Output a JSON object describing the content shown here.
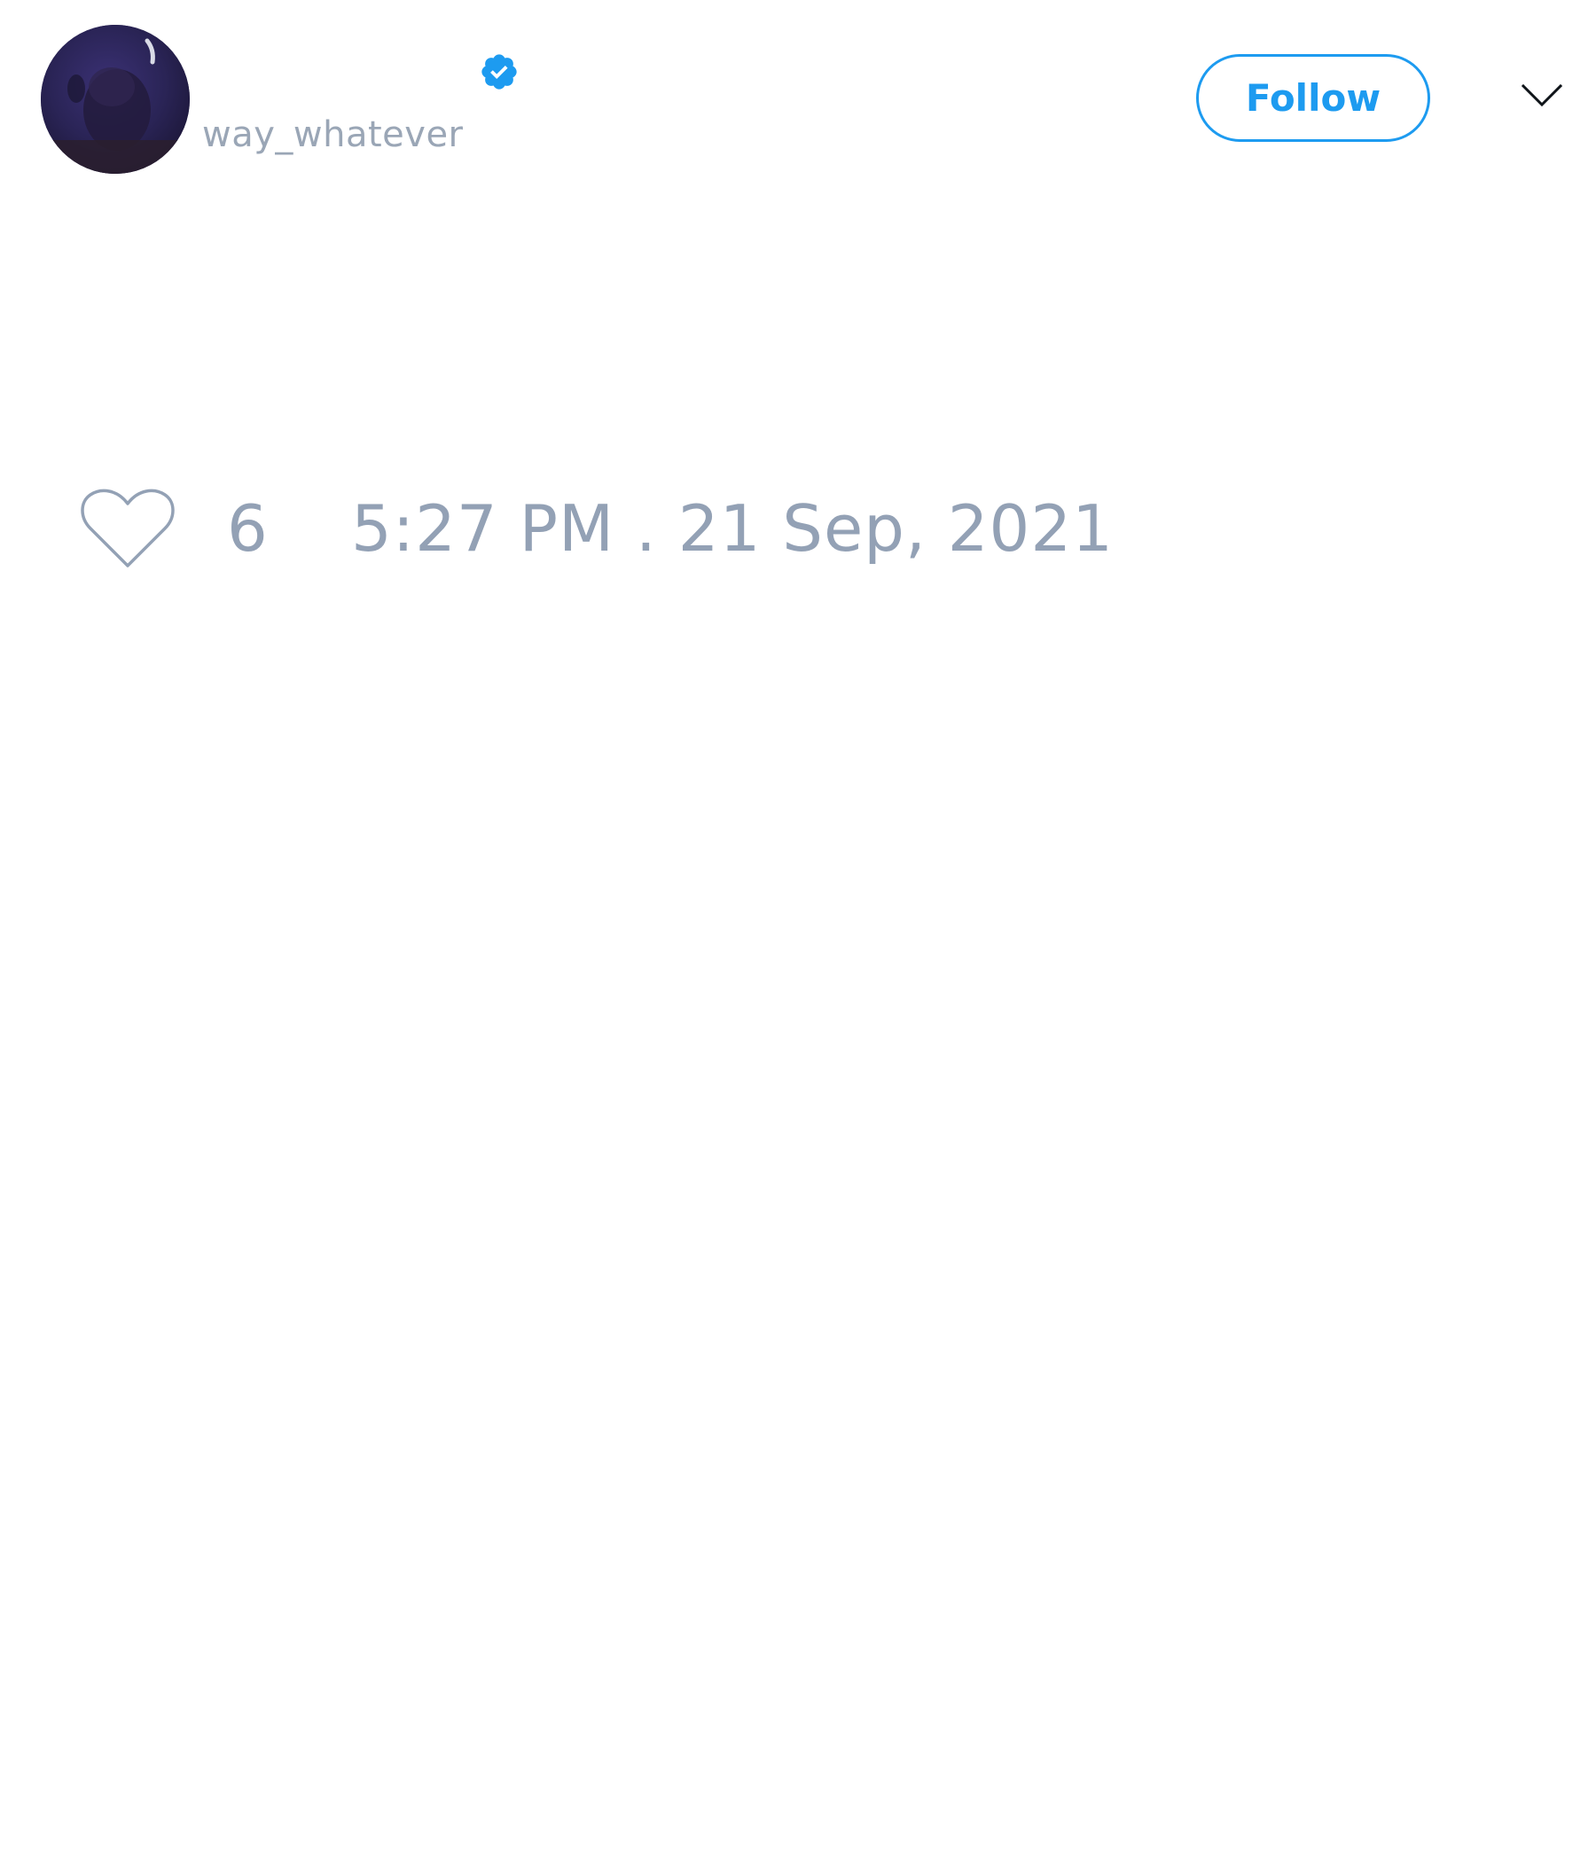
{
  "tweet": {
    "author": {
      "handle": "way_whatever",
      "verified": true,
      "avatar_icon": "user-avatar",
      "verified_icon": "verified-badge-icon",
      "verified_color": "#1d9bf0"
    },
    "follow_button": {
      "label": "Follow",
      "color": "#1d9bf0"
    },
    "menu": {
      "icon": "chevron-down-icon"
    },
    "likes": {
      "icon": "heart-icon",
      "count": "6"
    },
    "timestamp": "5:27 PM . 21 Sep, 2021",
    "muted_text_color": "#93a1b5"
  }
}
